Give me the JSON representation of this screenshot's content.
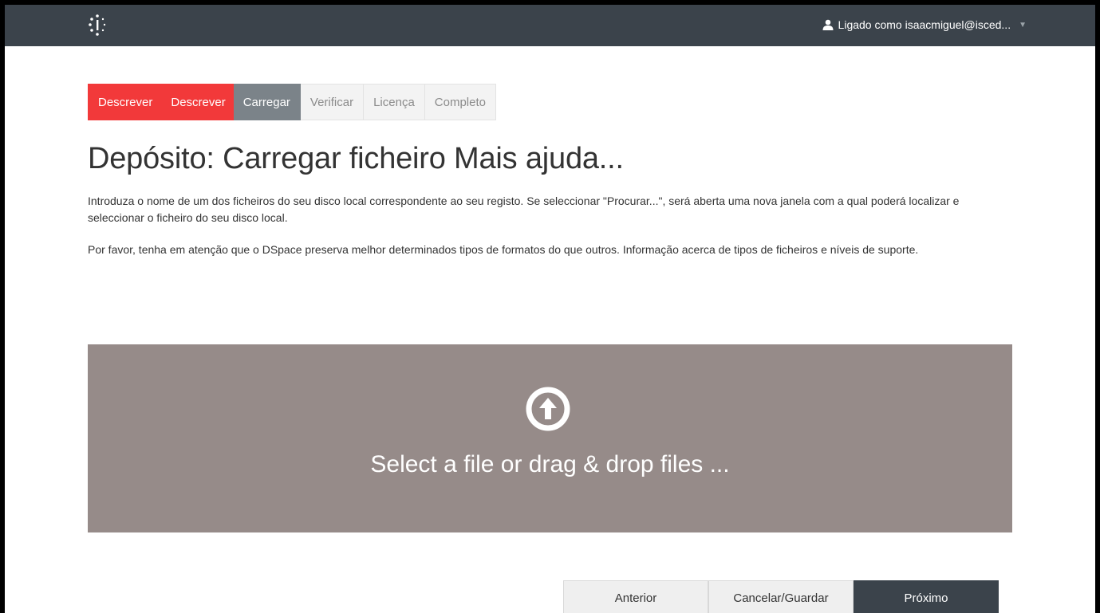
{
  "header": {
    "user_label": "Ligado como isaacmiguel@isced...",
    "icons": {
      "logo": "dspace-logo-icon",
      "user": "user-icon",
      "caret": "caret-down-icon"
    }
  },
  "steps": [
    {
      "label": "Descrever",
      "state": "done"
    },
    {
      "label": "Descrever",
      "state": "done"
    },
    {
      "label": "Carregar",
      "state": "active"
    },
    {
      "label": "Verificar",
      "state": "todo"
    },
    {
      "label": "Licença",
      "state": "todo"
    },
    {
      "label": "Completo",
      "state": "todo"
    }
  ],
  "page": {
    "title": "Depósito: Carregar ficheiro Mais ajuda...",
    "paragraph1": "Introduza o nome de um dos ficheiros do seu disco local correspondente ao seu registo. Se seleccionar \"Procurar...\", será aberta uma nova janela com a qual poderá localizar e seleccionar o ficheiro do seu disco local.",
    "paragraph2": "Por favor, tenha em atenção que o DSpace preserva melhor determinados tipos de formatos do que outros. Informação acerca de tipos de ficheiros e níveis de suporte."
  },
  "dropzone": {
    "text": "Select a file or drag & drop files ...",
    "icon": "upload-circle-icon"
  },
  "actions": {
    "previous": "Anterior",
    "cancel_save": "Cancelar/Guardar",
    "next": "Próximo"
  },
  "colors": {
    "topbar": "#3b434b",
    "step_done": "#f2393a",
    "step_active": "#7b8389",
    "dropzone": "#968b89"
  }
}
